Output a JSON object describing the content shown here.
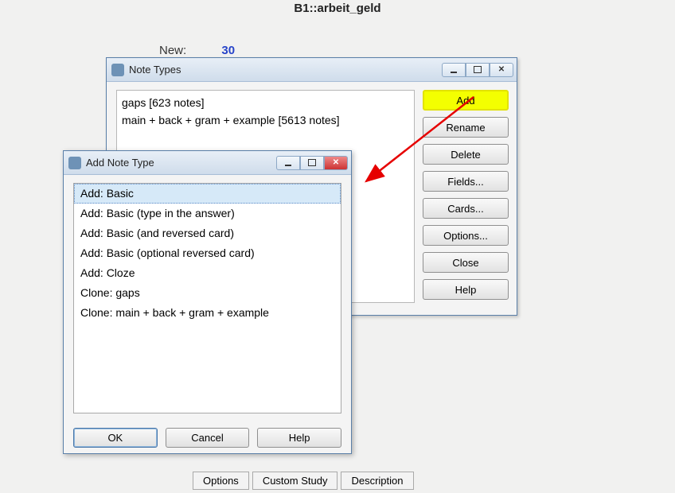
{
  "deck_title": "B1::arbeit_geld",
  "stats": {
    "new_label": "New:",
    "new_count": "30"
  },
  "bottom_buttons": {
    "options": "Options",
    "custom_study": "Custom Study",
    "description": "Description"
  },
  "note_types_dialog": {
    "title": "Note Types",
    "list": [
      "gaps [623 notes]",
      "main + back + gram + example [5613 notes]"
    ],
    "buttons": {
      "add": "Add",
      "rename": "Rename",
      "delete": "Delete",
      "fields": "Fields...",
      "cards": "Cards...",
      "options": "Options...",
      "close": "Close",
      "help": "Help"
    }
  },
  "add_note_type_dialog": {
    "title": "Add Note Type",
    "options": [
      "Add: Basic",
      "Add: Basic (type in the answer)",
      "Add: Basic (and reversed card)",
      "Add: Basic (optional reversed card)",
      "Add: Cloze",
      "Clone: gaps",
      "Clone: main + back + gram + example"
    ],
    "selected_index": 0,
    "buttons": {
      "ok": "OK",
      "cancel": "Cancel",
      "help": "Help"
    }
  },
  "annotation": {
    "arrow_color": "#e60000"
  }
}
